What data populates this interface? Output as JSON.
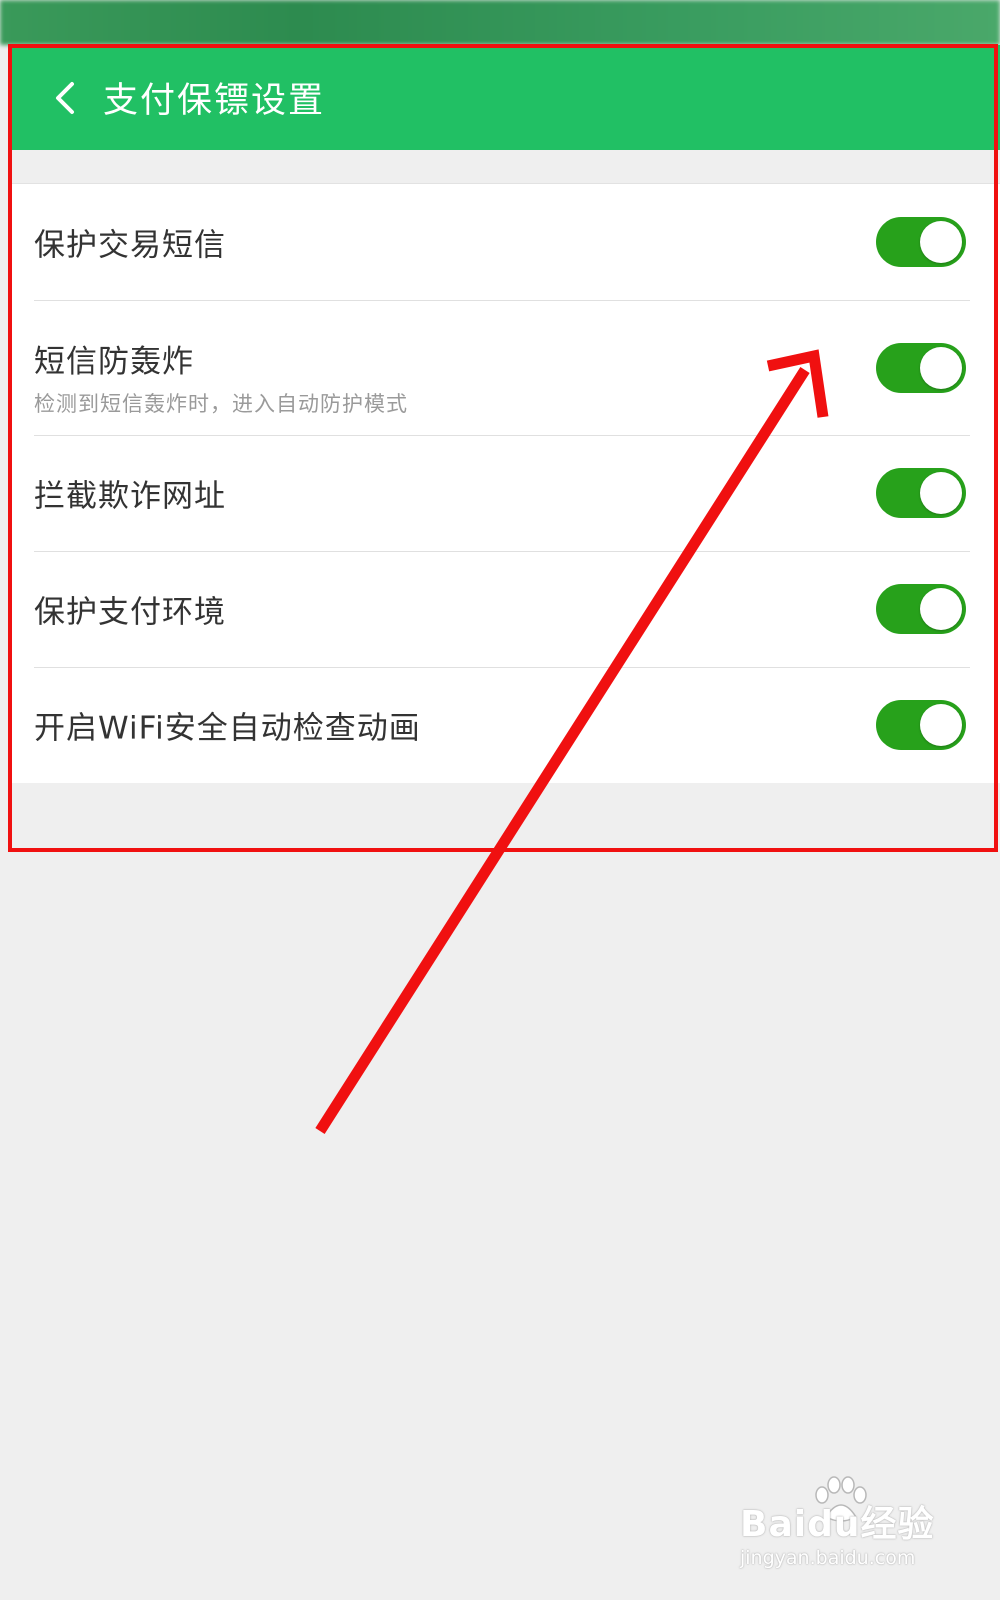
{
  "header": {
    "title": "支付保镖设置",
    "back_icon": "chevron-left-icon"
  },
  "settings": [
    {
      "title": "保护交易短信",
      "subtitle": "",
      "enabled": true
    },
    {
      "title": "短信防轰炸",
      "subtitle": "检测到短信轰炸时，进入自动防护模式",
      "enabled": true
    },
    {
      "title": "拦截欺诈网址",
      "subtitle": "",
      "enabled": true
    },
    {
      "title": "保护支付环境",
      "subtitle": "",
      "enabled": true
    },
    {
      "title": "开启WiFi安全自动检查动画",
      "subtitle": "",
      "enabled": true
    }
  ],
  "colors": {
    "header_bg": "#21c064",
    "toggle_on": "#27a11b",
    "annotation": "#f01010"
  },
  "watermark": {
    "brand": "Baidu经验",
    "url": "jingyan.baidu.com"
  }
}
